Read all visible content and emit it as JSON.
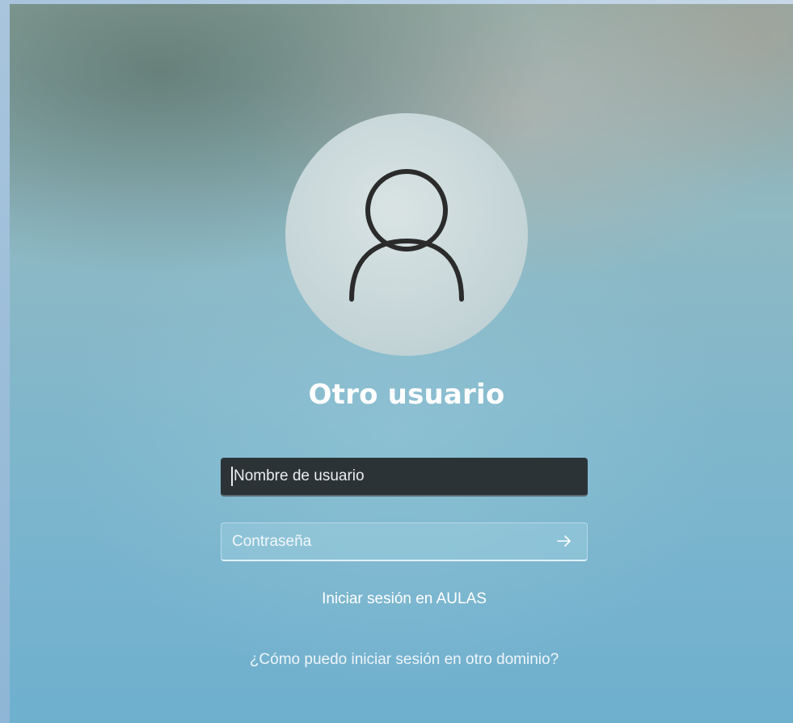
{
  "login": {
    "avatar_icon": "user-avatar-icon",
    "user_name": "Otro usuario",
    "username_field": {
      "placeholder": "Nombre de usuario",
      "value": ""
    },
    "password_field": {
      "placeholder": "Contraseña",
      "value": "",
      "submit_icon": "arrow-right-icon"
    },
    "domain_text": "Iniciar sesión en AULAS",
    "help_link": "¿Cómo puedo iniciar sesión en otro dominio?"
  },
  "colors": {
    "input_active_bg": "#2c3337",
    "text": "#ffffff",
    "avatar_bg": "#c9d8da"
  }
}
